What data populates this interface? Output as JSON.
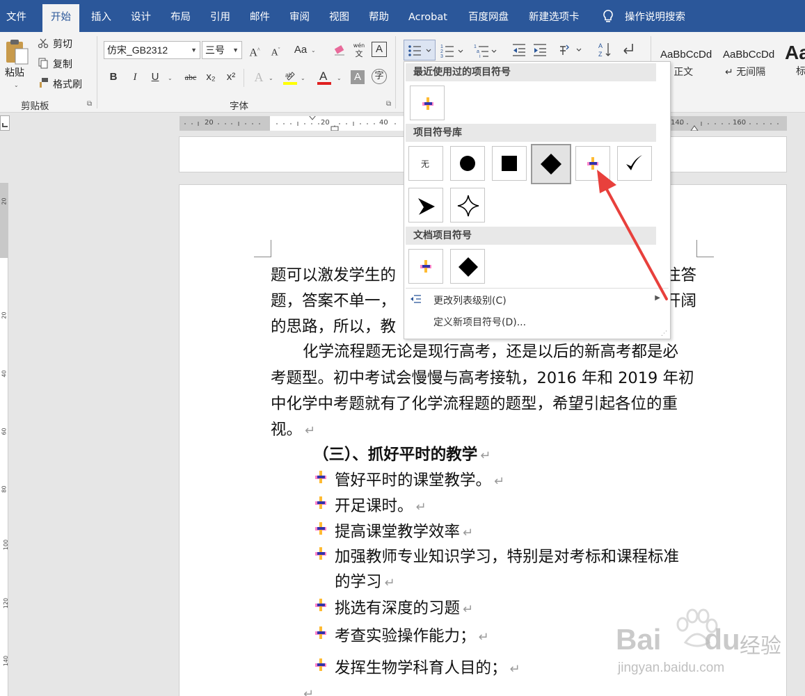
{
  "tabs": [
    "文件",
    "开始",
    "插入",
    "设计",
    "布局",
    "引用",
    "邮件",
    "审阅",
    "视图",
    "帮助",
    "Acrobat",
    "百度网盘",
    "新建选项卡"
  ],
  "active_tab_index": 1,
  "tell_me": "操作说明搜索",
  "clipboard": {
    "paste": "粘贴",
    "cut": "剪切",
    "copy": "复制",
    "format_painter": "格式刷",
    "group_label": "剪贴板"
  },
  "font_group": {
    "font_name": "仿宋_GB2312",
    "font_size": "三号",
    "group_label": "字体",
    "phonetic_label": "wén",
    "buttons": [
      "B",
      "I",
      "U",
      "abc",
      "x₂",
      "x²"
    ],
    "grow": "A",
    "shrink": "A",
    "case": "Aa"
  },
  "styles": [
    {
      "preview": "AaBbCcDd",
      "name": "正文"
    },
    {
      "preview": "AaBbCcDd",
      "name": "无间隔"
    },
    {
      "preview": "Aa",
      "name": "标"
    }
  ],
  "ruler_numbers": [
    "20",
    "20",
    "40",
    "140",
    "160"
  ],
  "vruler_numbers": [
    "20",
    "20",
    "40",
    "60",
    "80",
    "100",
    "120",
    "140"
  ],
  "bullet_dropdown": {
    "recent_header": "最近使用过的项目符号",
    "library_header": "项目符号库",
    "library_none": "无",
    "document_header": "文档项目符号",
    "change_level": "更改列表级别(C)",
    "define_new": "定义新项目符号(D)..."
  },
  "document": {
    "line1_left": "题可以激发学生的",
    "line1_right": "注答",
    "line2_left": "题，答案不单一，",
    "line2_right": "开阔",
    "line3_left": "的思路，所以，教",
    "line4": "化学流程题无论是现行高考，还是以后的新高考都是必",
    "line5": "考题型。初中考试会慢慢与高考接轨，2016 年和 2019 年初",
    "line6": "中化学中考题就有了化学流程题的题型，希望引起各位的重",
    "line7": "视。",
    "heading": "（三）、抓好平时的教学",
    "bullets": [
      "管好平时的课堂教学。",
      "开足课时。",
      "提高课堂教学效率",
      "加强教师专业知识学习，特别是对考标和课程标准",
      "挑选有深度的习题",
      "考查实验操作能力；",
      "发挥生物学科育人目的；"
    ],
    "bullet4_cont": "的学习",
    "return_mark": "↵"
  },
  "watermark": {
    "brand": "Bai",
    "brand2": "du",
    "cn": "经验",
    "url": "jingyan.baidu.com"
  },
  "colors": {
    "accent": "#2b579a",
    "arrow": "#e8403c"
  }
}
